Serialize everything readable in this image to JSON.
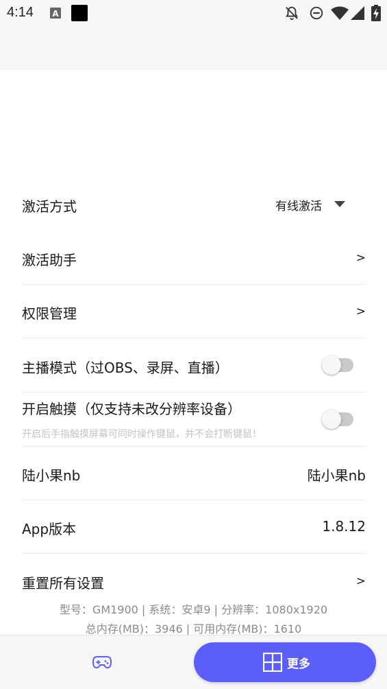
{
  "status_bar": {
    "time": "4:14",
    "icons": [
      "font-a-icon",
      "black-square-icon",
      "bell-off-icon",
      "do-not-disturb-icon",
      "wifi-icon",
      "signal-icon",
      "battery-charging-icon"
    ]
  },
  "settings": {
    "activation": {
      "label": "激活方式",
      "value": "有线激活"
    },
    "helper": {
      "label": "激活助手",
      "chevron": ">"
    },
    "permissions": {
      "label": "权限管理",
      "chevron": ">"
    },
    "streamer_mode": {
      "label": "主播模式（过OBS、录屏、直播）",
      "enabled": false
    },
    "touch": {
      "label": "开启触摸（仅支持未改分辨率设备）",
      "subtitle": "开启后手指触摸屏幕可同时操作键鼠，并不会打断键鼠！",
      "enabled": false
    },
    "user": {
      "label": "陆小果nb",
      "value": "陆小果nb"
    },
    "app_version": {
      "label": "App版本",
      "value": "1.8.12"
    },
    "reset": {
      "label": "重置所有设置",
      "chevron": ">"
    }
  },
  "device_info": {
    "line1": "型号：GM1900 | 系统：安卓9 | 分辨率：1080x1920",
    "line2": "总内存(MB)：3946 | 可用内存(MB)：1610"
  },
  "bottom_nav": {
    "game_icon": "gamepad-icon",
    "more_icon": "grid-icon",
    "more_label": "更多"
  },
  "colors": {
    "accent": "#5b5ef7",
    "toggle_off_track": "#c9c9c9",
    "subtitle_text": "#c4c4c4",
    "info_text": "#8a8a8a"
  }
}
